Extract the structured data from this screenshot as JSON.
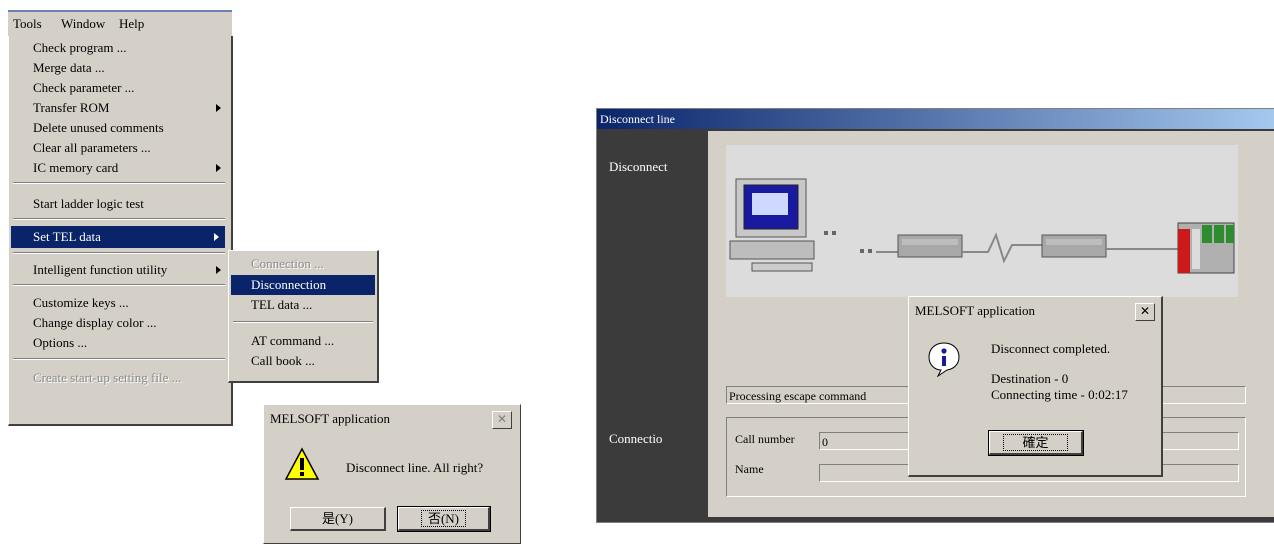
{
  "menubar": {
    "items": [
      "Tools",
      "Window",
      "Help"
    ]
  },
  "tools_menu": {
    "items": [
      {
        "label": "Check program ...",
        "submenu": false
      },
      {
        "label": "Merge data ...",
        "submenu": false
      },
      {
        "label": "Check parameter ...",
        "submenu": false
      },
      {
        "label": "Transfer ROM",
        "submenu": true
      },
      {
        "label": "Delete unused comments",
        "submenu": false
      },
      {
        "label": "Clear all parameters ...",
        "submenu": false
      },
      {
        "label": "IC memory card",
        "submenu": true
      },
      {
        "label": "Start ladder logic test",
        "submenu": false
      },
      {
        "label": "Set TEL data",
        "submenu": true,
        "selected": true
      },
      {
        "label": "Intelligent function utility",
        "submenu": true
      },
      {
        "label": "Customize keys ...",
        "submenu": false
      },
      {
        "label": "Change display color ...",
        "submenu": false
      },
      {
        "label": "Options ...",
        "submenu": false
      },
      {
        "label": "Create start-up setting file ...",
        "disabled": true
      }
    ]
  },
  "tel_submenu": {
    "items": [
      {
        "label": "Connection ...",
        "disabled": true
      },
      {
        "label": "Disconnection",
        "selected": true
      },
      {
        "label": "TEL data ..."
      },
      {
        "label": "AT command ..."
      },
      {
        "label": "Call book ..."
      }
    ]
  },
  "confirm_dialog": {
    "title": "MELSOFT application",
    "message": "Disconnect line.  All right?",
    "yes_label": "是(Y)",
    "no_label": "否(N)"
  },
  "disconnect_window": {
    "title": "Disconnect line",
    "disconnect_label": "Disconnect",
    "connection_label": "Connectio",
    "status": "Processing escape command",
    "call_number_label": "Call number",
    "call_number_value": "0",
    "name_label": "Name"
  },
  "info_dialog": {
    "title": "MELSOFT application",
    "line1": "Disconnect completed.",
    "line2": "Destination - 0",
    "line3": "Connecting time - 0:02:17",
    "ok_label": "確定"
  },
  "colors": {
    "selection": "#0a246a",
    "face": "#d4d0c8",
    "frame_dark": "#3b3b3b"
  }
}
